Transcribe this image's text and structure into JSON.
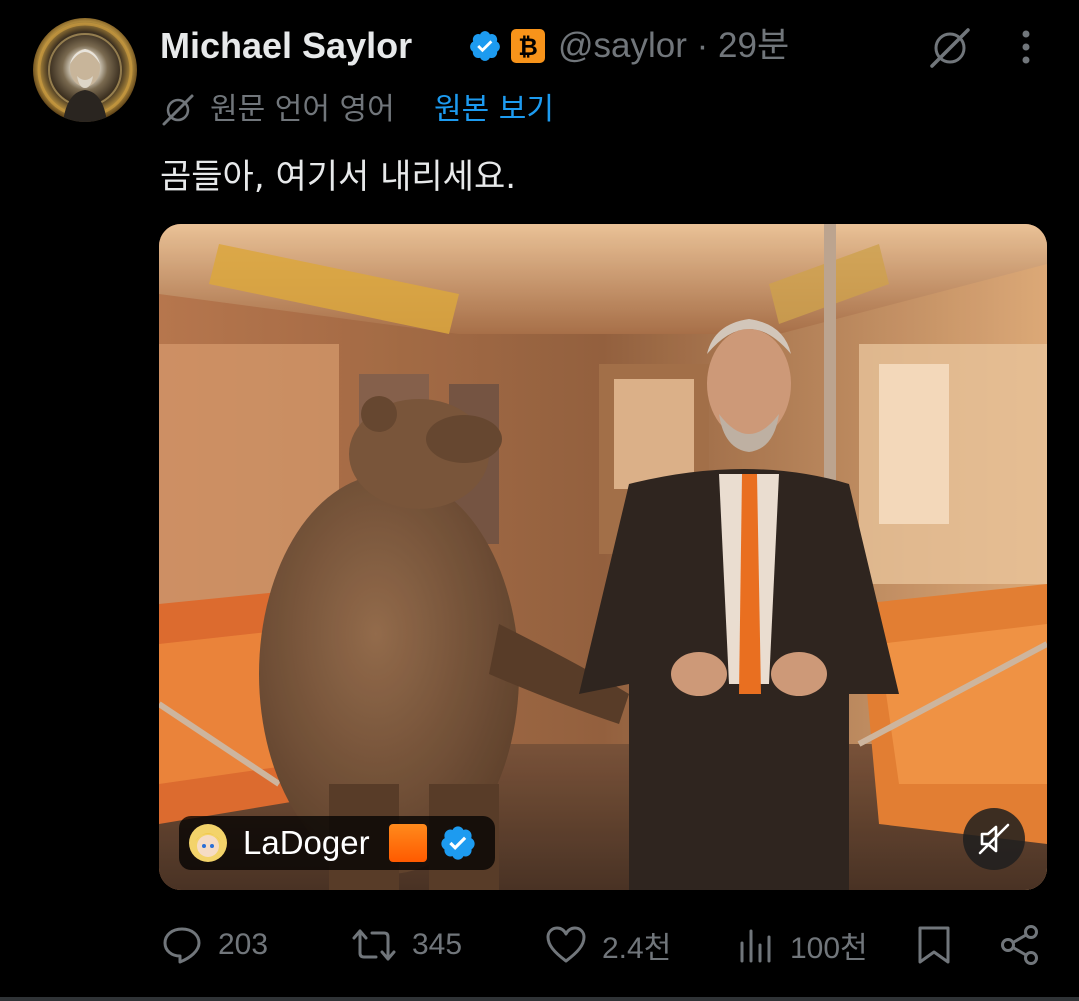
{
  "author": {
    "name": "Michael Saylor",
    "handle": "@saylor",
    "separator": "·",
    "time": "29분"
  },
  "translation": {
    "note": "원문 언어 영어",
    "show_original": "원본 보기"
  },
  "tweet": {
    "text": "곰들아, 여기서 내리세요."
  },
  "media": {
    "credit_name": "LaDoger",
    "mute_icon": "speaker-muted-icon"
  },
  "actions": {
    "replies": "203",
    "reposts": "345",
    "likes": "2.4천",
    "views": "100천"
  },
  "colors": {
    "accent": "#1d9bf0",
    "muted_text": "#71767b",
    "text": "#e7e9ea",
    "bitcoin": "#f7931a"
  }
}
